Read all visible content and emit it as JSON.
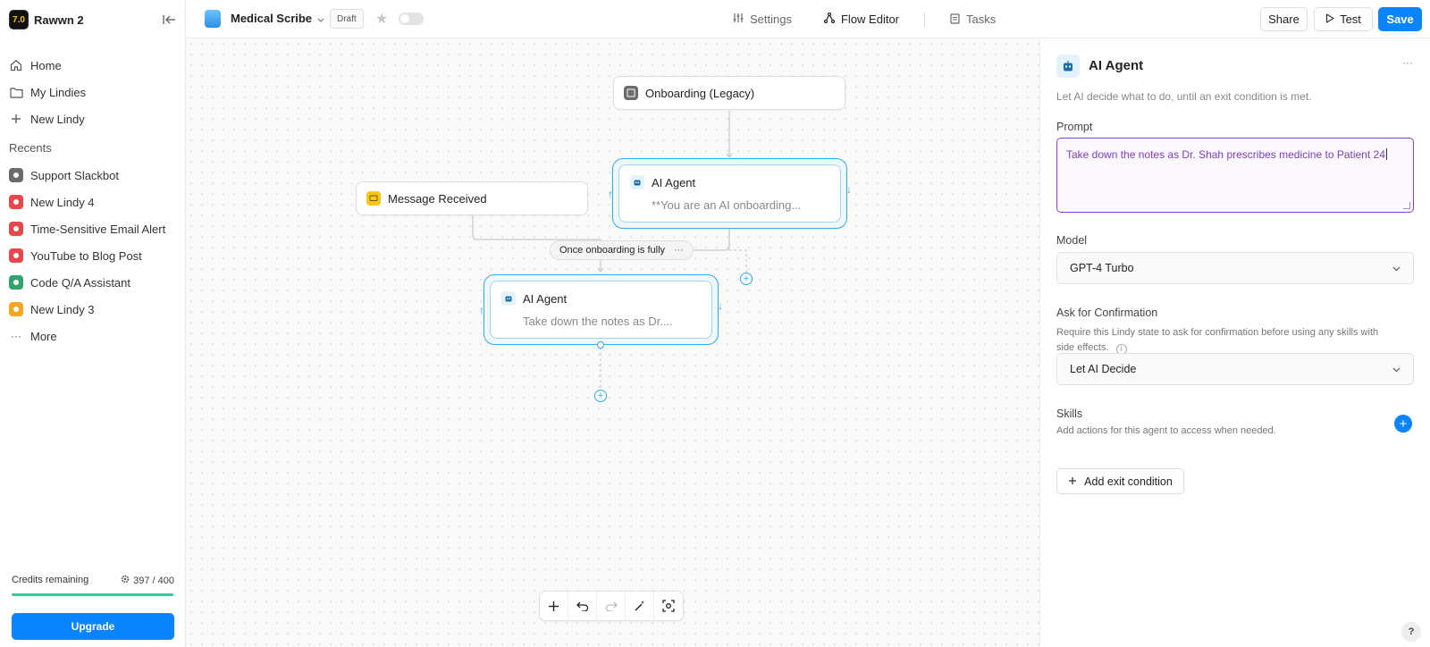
{
  "sidebar": {
    "workspace_logo": "7.0",
    "workspace_name": "Rawwn 2",
    "nav": [
      {
        "label": "Home",
        "icon": "home-icon"
      },
      {
        "label": "My Lindies",
        "icon": "folder-icon"
      },
      {
        "label": "New Lindy",
        "icon": "plus-icon"
      }
    ],
    "recents_label": "Recents",
    "recents": [
      {
        "label": "Support Slackbot",
        "color": "#6b6b6b"
      },
      {
        "label": "New Lindy 4",
        "color": "#e5484d"
      },
      {
        "label": "Time-Sensitive Email Alert",
        "color": "#e5484d"
      },
      {
        "label": "YouTube to Blog Post",
        "color": "#e5484d"
      },
      {
        "label": "Code Q/A Assistant",
        "color": "#30a46c"
      },
      {
        "label": "New Lindy 3",
        "color": "#f5a623"
      }
    ],
    "more_label": "More",
    "credits_label": "Credits remaining",
    "credits_value": "397 / 400",
    "credits_fraction": 0.9925,
    "upgrade_label": "Upgrade"
  },
  "topbar": {
    "flow_name": "Medical Scribe",
    "draft_label": "Draft",
    "tabs": [
      {
        "label": "Settings",
        "icon": "sliders-icon"
      },
      {
        "label": "Flow Editor",
        "icon": "flow-icon"
      },
      {
        "label": "Tasks",
        "icon": "clipboard-icon"
      }
    ],
    "share_label": "Share",
    "test_label": "Test",
    "save_label": "Save"
  },
  "canvas": {
    "nodes": {
      "onboarding": "Onboarding (Legacy)",
      "message_received": "Message Received",
      "agent_1_title": "AI Agent",
      "agent_1_desc": "**You are an AI onboarding...",
      "agent_2_title": "AI Agent",
      "agent_2_desc": "Take down the notes as Dr...."
    },
    "condition_label": "Once onboarding is fully",
    "condition_more": "···"
  },
  "panel": {
    "title": "AI Agent",
    "more": "···",
    "subtitle": "Let AI decide what to do, until an exit condition is met.",
    "prompt_label": "Prompt",
    "prompt_value": "Take down the notes as Dr. Shah prescribes medicine to Patient 24",
    "model_label": "Model",
    "model_value": "GPT-4 Turbo",
    "confirm_label": "Ask for Confirmation",
    "confirm_help": "Require this Lindy state to ask for confirmation before using any skills with side effects.",
    "confirm_value": "Let AI Decide",
    "skills_label": "Skills",
    "skills_help": "Add actions for this agent to access when needed.",
    "exit_label": "Add exit condition",
    "help": "?"
  },
  "colors": {
    "accent": "#0a84ff",
    "agent_border": "#35a9e8",
    "prompt_border": "#8a3fd1",
    "credits_bar": "#3bc996"
  }
}
